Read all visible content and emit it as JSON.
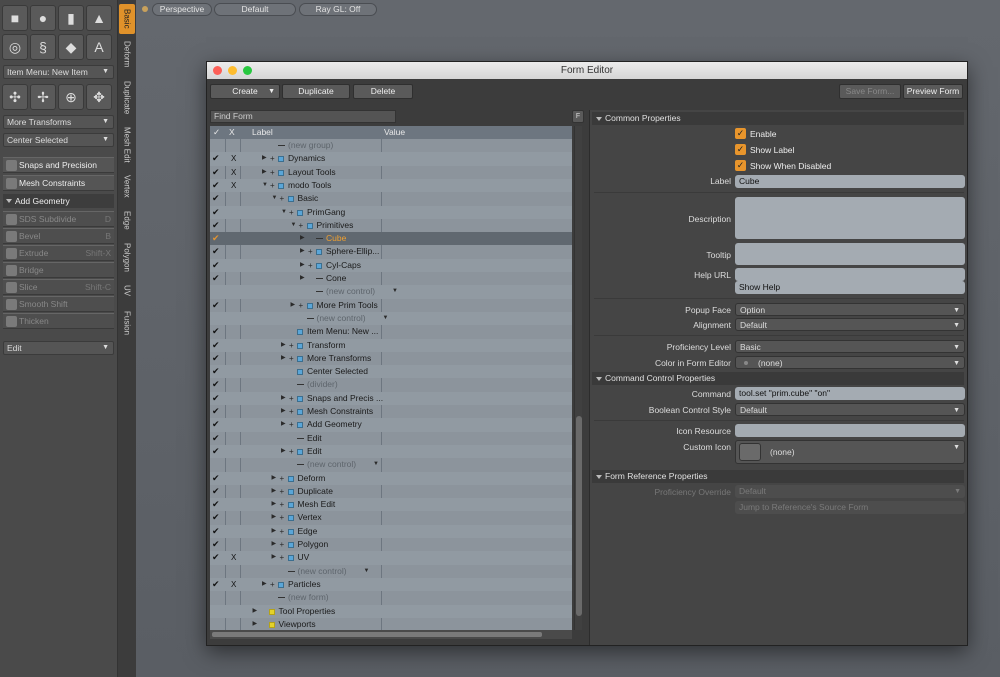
{
  "viewport": {
    "buttons": [
      "Perspective",
      "Default",
      "Ray GL: Off"
    ]
  },
  "left_panel": {
    "item_menu": "Item Menu: New Item",
    "more_transforms": "More Transforms",
    "center_selected": "Center Selected",
    "buttons": [
      "Snaps and Precision",
      "Mesh Constraints"
    ],
    "section": "Add Geometry",
    "tools": [
      {
        "label": "SDS Subdivide",
        "shortcut": "D"
      },
      {
        "label": "Bevel",
        "shortcut": "B"
      },
      {
        "label": "Extrude",
        "shortcut": "Shift-X"
      },
      {
        "label": "Bridge",
        "shortcut": ""
      },
      {
        "label": "Slice",
        "shortcut": "Shift-C"
      },
      {
        "label": "Smooth Shift",
        "shortcut": ""
      },
      {
        "label": "Thicken",
        "shortcut": ""
      }
    ],
    "edit": "Edit"
  },
  "vertical_tabs": [
    "Basic",
    "Deform",
    "Duplicate",
    "Mesh Edit",
    "Vertex",
    "Edge",
    "Polygon",
    "UV",
    "Fusion"
  ],
  "form_editor": {
    "title": "Form Editor",
    "toolbar": {
      "create": "Create",
      "duplicate": "Duplicate",
      "delete": "Delete",
      "save_form": "Save Form...",
      "preview_form": "Preview Form"
    },
    "find_placeholder": "Find Form",
    "find_button": "F",
    "tree_columns": {
      "check": "✓",
      "x": "X",
      "label": "Label",
      "value": "Value"
    },
    "tree_rows": [
      {
        "label": "(new group)",
        "chk": "",
        "x": "",
        "depth": 0,
        "icon": "dash",
        "gray": true
      },
      {
        "label": "Dynamics",
        "chk": "✔",
        "x": "X",
        "depth": 0,
        "icon": "form",
        "expand": "▶",
        "plus": true
      },
      {
        "label": "Layout Tools",
        "chk": "✔",
        "x": "X",
        "depth": 0,
        "icon": "form",
        "expand": "▶",
        "plus": true
      },
      {
        "label": "modo Tools",
        "chk": "✔",
        "x": "X",
        "depth": 0,
        "icon": "form",
        "expand": "▼",
        "plus": true
      },
      {
        "label": "Basic",
        "chk": "✔",
        "x": "",
        "depth": 1,
        "icon": "form",
        "expand": "▼",
        "plus": true
      },
      {
        "label": "PrimGang",
        "chk": "✔",
        "x": "",
        "depth": 2,
        "icon": "form",
        "expand": "▼",
        "plus": true
      },
      {
        "label": "Primitives",
        "chk": "✔",
        "x": "",
        "depth": 3,
        "icon": "form",
        "expand": "▼",
        "plus": true
      },
      {
        "label": "Cube",
        "chk": "✔",
        "x": "",
        "depth": 4,
        "icon": "dash",
        "expand": "▶",
        "sel": true
      },
      {
        "label": "Sphere-Ellip...",
        "chk": "✔",
        "x": "",
        "depth": 4,
        "icon": "form",
        "expand": "▶",
        "plus": true
      },
      {
        "label": "Cyl-Caps",
        "chk": "✔",
        "x": "",
        "depth": 4,
        "icon": "form",
        "expand": "▶",
        "plus": true
      },
      {
        "label": "Cone",
        "chk": "✔",
        "x": "",
        "depth": 4,
        "icon": "dash",
        "expand": "▶"
      },
      {
        "label": "(new control)",
        "chk": "",
        "x": "",
        "depth": 4,
        "icon": "dash",
        "gray": true,
        "drop": true
      },
      {
        "label": "More Prim Tools",
        "chk": "✔",
        "x": "",
        "depth": 3,
        "icon": "form",
        "expand": "▶",
        "plus": true
      },
      {
        "label": "(new control)",
        "chk": "",
        "x": "",
        "depth": 3,
        "icon": "dash",
        "gray": true,
        "drop": true
      },
      {
        "label": "Item Menu: New ...",
        "chk": "✔",
        "x": "",
        "depth": 2,
        "icon": "form"
      },
      {
        "label": "Transform",
        "chk": "✔",
        "x": "",
        "depth": 2,
        "icon": "form",
        "expand": "▶",
        "plus": true
      },
      {
        "label": "More Transforms",
        "chk": "✔",
        "x": "",
        "depth": 2,
        "icon": "form",
        "expand": "▶",
        "plus": true
      },
      {
        "label": "Center Selected",
        "chk": "✔",
        "x": "",
        "depth": 2,
        "icon": "form"
      },
      {
        "label": "(divider)",
        "chk": "✔",
        "x": "",
        "depth": 2,
        "icon": "dash",
        "gray": true
      },
      {
        "label": "Snaps and Precis ...",
        "chk": "✔",
        "x": "",
        "depth": 2,
        "icon": "form",
        "expand": "▶",
        "plus": true
      },
      {
        "label": "Mesh Constraints",
        "chk": "✔",
        "x": "",
        "depth": 2,
        "icon": "form",
        "expand": "▶",
        "plus": true
      },
      {
        "label": "Add Geometry",
        "chk": "✔",
        "x": "",
        "depth": 2,
        "icon": "form",
        "expand": "▶",
        "plus": true
      },
      {
        "label": "Edit",
        "chk": "✔",
        "x": "",
        "depth": 2,
        "icon": "dash"
      },
      {
        "label": "Edit",
        "chk": "✔",
        "x": "",
        "depth": 2,
        "icon": "form",
        "expand": "▶",
        "plus": true
      },
      {
        "label": "(new control)",
        "chk": "",
        "x": "",
        "depth": 2,
        "icon": "dash",
        "gray": true,
        "drop": true
      },
      {
        "label": "Deform",
        "chk": "✔",
        "x": "",
        "depth": 1,
        "icon": "form",
        "expand": "▶",
        "plus": true
      },
      {
        "label": "Duplicate",
        "chk": "✔",
        "x": "",
        "depth": 1,
        "icon": "form",
        "expand": "▶",
        "plus": true
      },
      {
        "label": "Mesh Edit",
        "chk": "✔",
        "x": "",
        "depth": 1,
        "icon": "form",
        "expand": "▶",
        "plus": true
      },
      {
        "label": "Vertex",
        "chk": "✔",
        "x": "",
        "depth": 1,
        "icon": "form",
        "expand": "▶",
        "plus": true
      },
      {
        "label": "Edge",
        "chk": "✔",
        "x": "",
        "depth": 1,
        "icon": "form",
        "expand": "▶",
        "plus": true
      },
      {
        "label": "Polygon",
        "chk": "✔",
        "x": "",
        "depth": 1,
        "icon": "form",
        "expand": "▶",
        "plus": true
      },
      {
        "label": "UV",
        "chk": "✔",
        "x": "X",
        "depth": 1,
        "icon": "form",
        "expand": "▶",
        "plus": true
      },
      {
        "label": "(new control)",
        "chk": "",
        "x": "",
        "depth": 1,
        "icon": "dash",
        "gray": true,
        "drop": true
      },
      {
        "label": "Particles",
        "chk": "✔",
        "x": "X",
        "depth": 0,
        "icon": "form",
        "expand": "▶",
        "plus": true
      },
      {
        "label": "(new form)",
        "chk": "",
        "x": "",
        "depth": 0,
        "icon": "dash",
        "gray": true
      },
      {
        "label": "Tool Properties",
        "chk": "",
        "x": "",
        "depth": -1,
        "icon": "fold",
        "expand": "▶"
      },
      {
        "label": "Viewports",
        "chk": "",
        "x": "",
        "depth": -1,
        "icon": "fold",
        "expand": "▶"
      }
    ],
    "props": {
      "common_header": "Common Properties",
      "enable": "Enable",
      "show_label": "Show Label",
      "show_when_disabled": "Show When Disabled",
      "label_label": "Label",
      "label_value": "Cube",
      "description_label": "Description",
      "tooltip_label": "Tooltip",
      "help_url_label": "Help URL",
      "show_help": "Show Help",
      "popup_face_label": "Popup Face",
      "popup_face_value": "Option",
      "alignment_label": "Alignment",
      "alignment_value": "Default",
      "proficiency_label": "Proficiency Level",
      "proficiency_value": "Basic",
      "color_label": "Color in Form Editor",
      "color_value": "(none)",
      "command_header": "Command Control Properties",
      "command_label": "Command",
      "command_value": "tool.set \"prim.cube\" \"on\"",
      "boolean_label": "Boolean Control Style",
      "boolean_value": "Default",
      "icon_resource_label": "Icon Resource",
      "custom_icon_label": "Custom Icon",
      "custom_icon_value": "(none)",
      "reference_header": "Form Reference Properties",
      "prof_override_label": "Proficiency Override",
      "prof_override_value": "Default",
      "jump_button": "Jump to Reference's Source Form"
    }
  }
}
